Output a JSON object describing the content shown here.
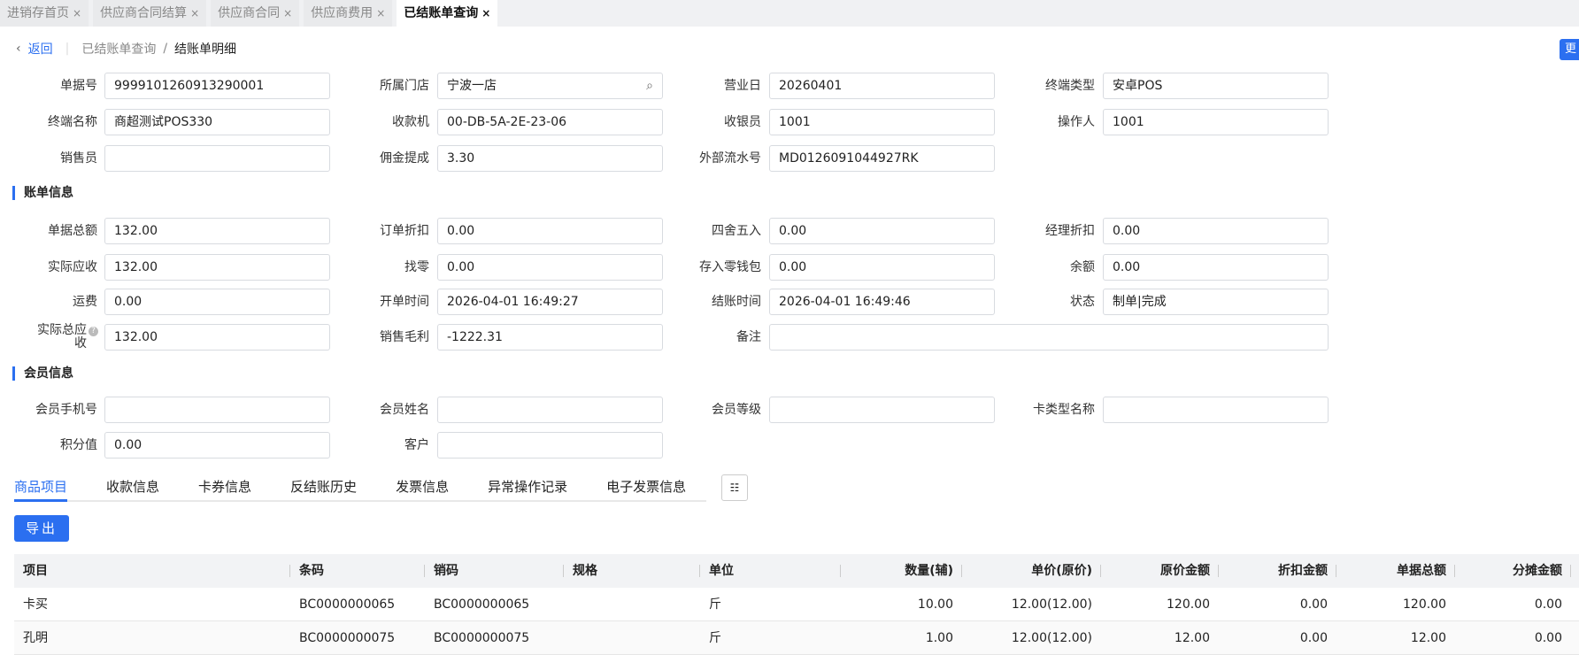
{
  "tabs": [
    {
      "label": "进销存首页"
    },
    {
      "label": "供应商合同结算"
    },
    {
      "label": "供应商合同"
    },
    {
      "label": "供应商费用"
    },
    {
      "label": "已结账单查询",
      "active": true
    }
  ],
  "close_glyph": "×",
  "breadcrumb": {
    "back": "返回",
    "prev": "已结账单查询",
    "sep": "/",
    "current": "结账单明细"
  },
  "more_button": "更",
  "header_fields": [
    {
      "label": "单据号",
      "value": "9999101260913290001"
    },
    {
      "label": "所属门店",
      "value": "宁波一店"
    },
    {
      "label": "营业日",
      "value": "20260401"
    },
    {
      "label": "终端类型",
      "value": "安卓POS"
    },
    {
      "label": "终端名称",
      "value": "商超测试POS330"
    },
    {
      "label": "收款机",
      "value": "00-DB-5A-2E-23-06"
    },
    {
      "label": "收银员",
      "value": "1001"
    },
    {
      "label": "操作人",
      "value": "1001"
    },
    {
      "label": "销售员",
      "value": ""
    },
    {
      "label": "佣金提成",
      "value": "3.30"
    },
    {
      "label": "外部流水号",
      "value": "MD0126091044927RK"
    }
  ],
  "bill_section": "账单信息",
  "bill_fields": [
    {
      "label": "单据总额",
      "value": "132.00"
    },
    {
      "label": "订单折扣",
      "value": "0.00"
    },
    {
      "label": "四舍五入",
      "value": "0.00"
    },
    {
      "label": "经理折扣",
      "value": "0.00"
    },
    {
      "label": "实际应收",
      "value": "132.00"
    },
    {
      "label": "找零",
      "value": "0.00"
    },
    {
      "label": "存入零钱包",
      "value": "0.00"
    },
    {
      "label": "余额",
      "value": "0.00"
    },
    {
      "label": "运费",
      "value": "0.00"
    },
    {
      "label": "开单时间",
      "value": "2026-04-01 16:49:27"
    },
    {
      "label": "结账时间",
      "value": "2026-04-01 16:49:46"
    },
    {
      "label": "状态",
      "value": "制单|完成"
    },
    {
      "label": "实际总应收",
      "value": "132.00"
    },
    {
      "label": "销售毛利",
      "value": "-1222.31"
    },
    {
      "label": "备注",
      "value": ""
    }
  ],
  "member_section": "会员信息",
  "member_fields": [
    {
      "label": "会员手机号",
      "value": ""
    },
    {
      "label": "会员姓名",
      "value": ""
    },
    {
      "label": "会员等级",
      "value": ""
    },
    {
      "label": "卡类型名称",
      "value": ""
    },
    {
      "label": "积分值",
      "value": "0.00"
    },
    {
      "label": "客户",
      "value": ""
    }
  ],
  "detail_tabs": [
    "商品项目",
    "收款信息",
    "卡券信息",
    "反结账历史",
    "发票信息",
    "异常操作记录",
    "电子发票信息"
  ],
  "export_label": "导出",
  "table": {
    "columns": [
      "项目",
      "条码",
      "销码",
      "规格",
      "单位",
      "数量(辅)",
      "单价(原价)",
      "原价金额",
      "折扣金额",
      "单据总额",
      "分摊金额"
    ],
    "rows": [
      [
        "卡买",
        "BC0000000065",
        "BC0000000065",
        "",
        "斤",
        "10.00",
        "12.00(12.00)",
        "120.00",
        "0.00",
        "120.00",
        "0.00"
      ],
      [
        "孔明",
        "BC0000000075",
        "BC0000000075",
        "",
        "斤",
        "1.00",
        "12.00(12.00)",
        "12.00",
        "0.00",
        "12.00",
        "0.00"
      ]
    ]
  },
  "colors": {
    "accent": "#2b6ff0"
  }
}
